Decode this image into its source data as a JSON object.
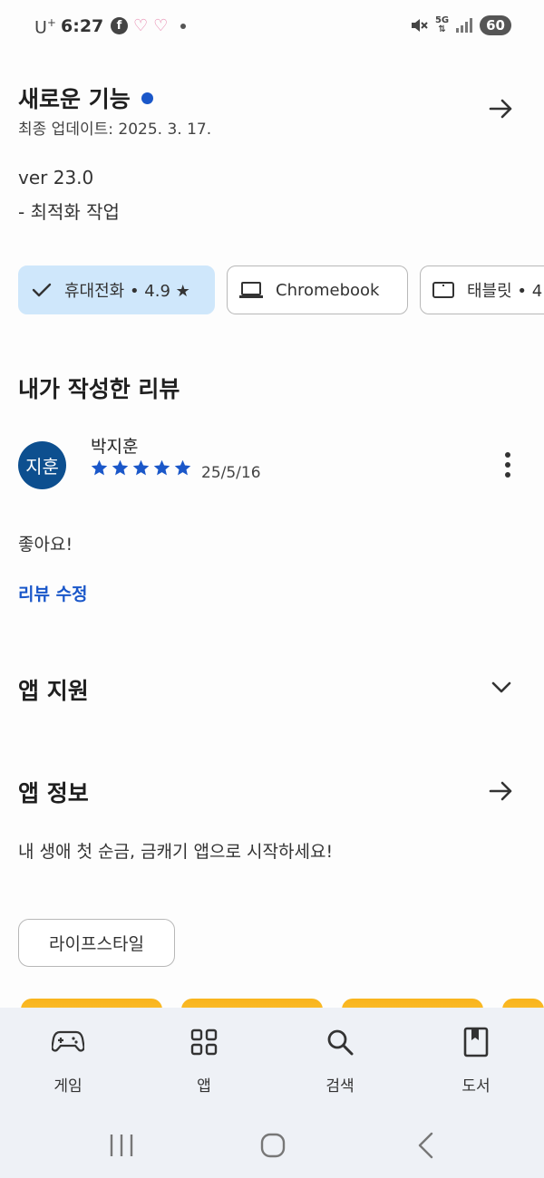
{
  "status_bar": {
    "carrier": "U",
    "carrier_sup": "+",
    "time": "6:27",
    "fb_glyph": "f",
    "network": "5G",
    "battery": "60"
  },
  "whats_new": {
    "title": "새로운 기능",
    "updated": "최종 업데이트: 2025. 3. 17.",
    "version": "ver 23.0",
    "note": "- 최적화 작업"
  },
  "devices": {
    "phone_label": "휴대전화 • 4.9 ★",
    "chromebook_label": "Chromebook",
    "tablet_label": "태블릿 • 4"
  },
  "my_review": {
    "heading": "내가 작성한 리뷰",
    "avatar_text": "지훈",
    "reviewer": "박지훈",
    "rating": 5,
    "date": "25/5/16",
    "text": "좋아요!",
    "edit_label": "리뷰 수정"
  },
  "app_support": {
    "heading": "앱 지원"
  },
  "app_info": {
    "heading": "앱 정보",
    "description": "내 생애 첫 순금, 금캐기 앱으로 시작하세요!",
    "category": "라이프스타일"
  },
  "bottom_nav": {
    "items": [
      {
        "label": "게임",
        "icon": "gamepad-icon"
      },
      {
        "label": "앱",
        "icon": "apps-grid-icon"
      },
      {
        "label": "검색",
        "icon": "search-icon"
      },
      {
        "label": "도서",
        "icon": "book-icon"
      }
    ]
  },
  "colors": {
    "accent": "#1a57c9",
    "chip_selected_bg": "#cfe7fb",
    "avatar_bg": "#0d4f8f",
    "nav_bg": "#eef1f6",
    "promo": "#f9b41b"
  }
}
